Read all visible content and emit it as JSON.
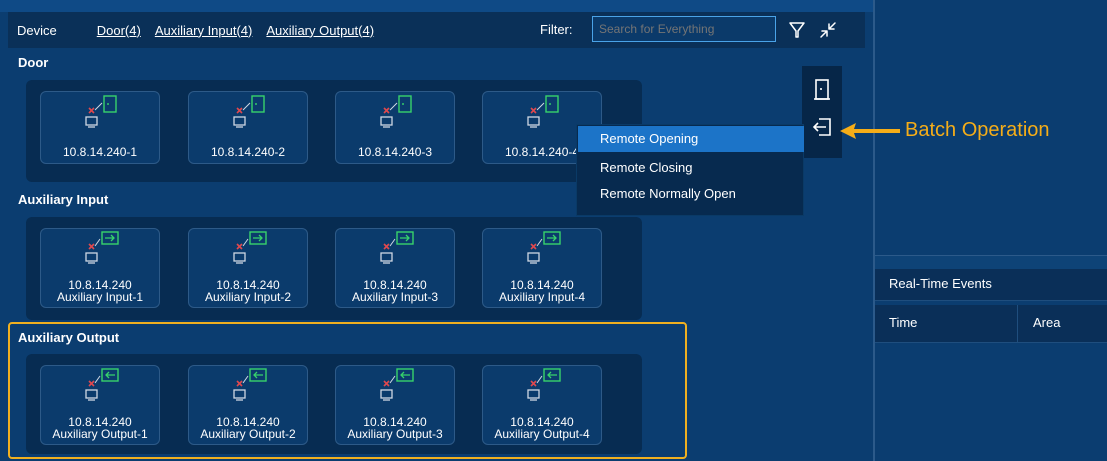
{
  "toolbar": {
    "device_label": "Device",
    "links": [
      "Door(4)",
      "Auxiliary Input(4)",
      "Auxiliary Output(4)"
    ],
    "filter_label": "Filter:",
    "search_placeholder": "Search for Everything",
    "filter_icon": "funnel-icon",
    "collapse_icon": "collapse-arrows-icon"
  },
  "sections": {
    "door": {
      "title": "Door",
      "items": [
        "10.8.14.240-1",
        "10.8.14.240-2",
        "10.8.14.240-3",
        "10.8.14.240-4"
      ]
    },
    "aux_input": {
      "title": "Auxiliary Input",
      "items": [
        {
          "ip": "10.8.14.240",
          "name": "Auxiliary Input-1"
        },
        {
          "ip": "10.8.14.240",
          "name": "Auxiliary Input-2"
        },
        {
          "ip": "10.8.14.240",
          "name": "Auxiliary Input-3"
        },
        {
          "ip": "10.8.14.240",
          "name": "Auxiliary Input-4"
        }
      ]
    },
    "aux_output": {
      "title": "Auxiliary Output",
      "items": [
        {
          "ip": "10.8.14.240",
          "name": "Auxiliary Output-1"
        },
        {
          "ip": "10.8.14.240",
          "name": "Auxiliary Output-2"
        },
        {
          "ip": "10.8.14.240",
          "name": "Auxiliary Output-3"
        },
        {
          "ip": "10.8.14.240",
          "name": "Auxiliary Output-4"
        }
      ]
    }
  },
  "context_menu": {
    "items": [
      "Remote Opening",
      "Remote Closing",
      "Remote Normally Open"
    ],
    "active_index": 0
  },
  "side_tools": {
    "icons": [
      "door-icon",
      "batch-exit-icon"
    ]
  },
  "callout": {
    "label": "Batch Operation",
    "color": "#f5ad18"
  },
  "realtime": {
    "title": "Real-Time Events",
    "columns": [
      "Time",
      "Area"
    ]
  },
  "colors": {
    "background": "#0b3d70",
    "highlight_border": "#f0b020",
    "menu_active": "#1c74c8",
    "status_offline": "#e0484e",
    "status_online": "#37d36b"
  }
}
